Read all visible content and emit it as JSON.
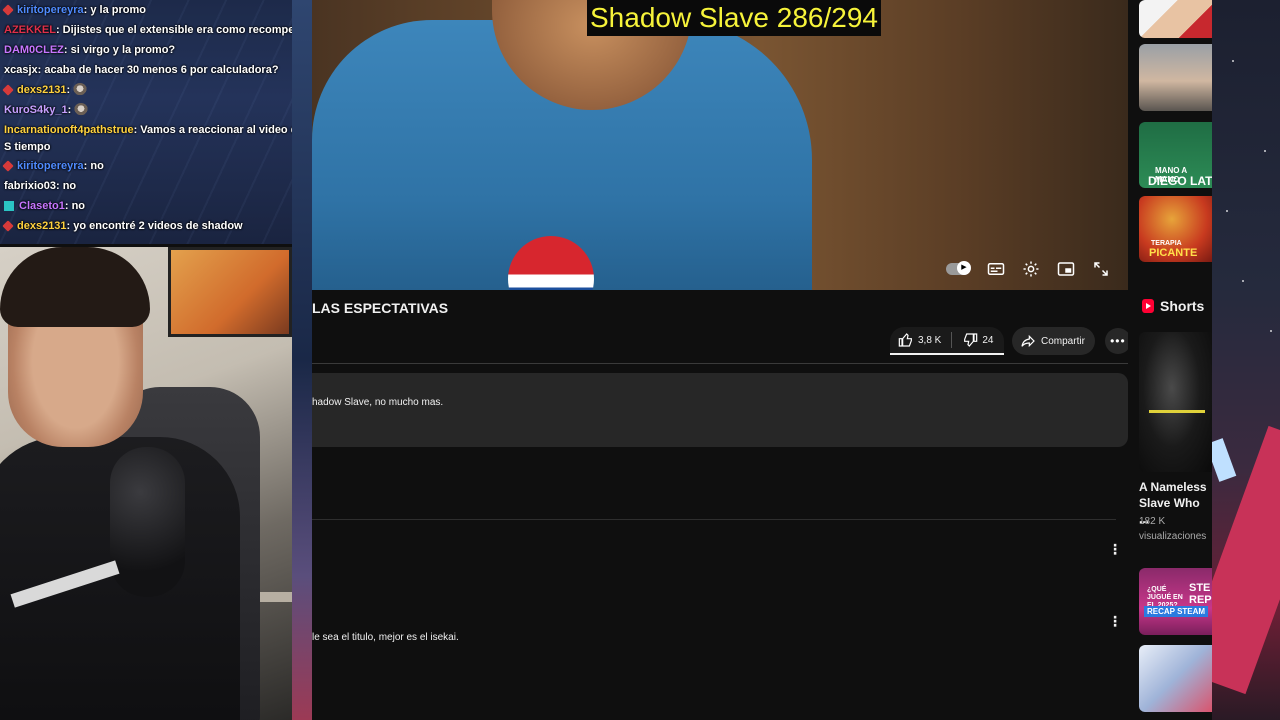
{
  "overlay": {
    "title": "Shadow Slave 286/294"
  },
  "chat": {
    "messages": [
      {
        "user": "kiritopereyra",
        "text": ": y la promo",
        "user_color": "#4f8bff",
        "badge": "#d63a3a"
      },
      {
        "user": "AZEKKEL",
        "text": ": Dijistes que el extensible era como recompensa p",
        "user_color": "#e0304a",
        "badge": ""
      },
      {
        "user": "DAM0CLEZ",
        "text": ": si virgo y la promo?",
        "user_color": "#c776ff",
        "badge": ""
      },
      {
        "user": "xcasjx",
        "text": ": acaba de hacer 30 menos 6 por calculadora?",
        "user_color": "#ffffff",
        "badge": ""
      },
      {
        "user": "dexs2131",
        "text": ":",
        "user_color": "#ffd23f",
        "badge": "#d63a3a"
      },
      {
        "user": "KuroS4ky_1",
        "text": ":",
        "user_color": "#c7a0ff",
        "badge": ""
      },
      {
        "user": "Incarnationoft4pathstrue",
        "text": ": Vamos a reaccionar al video del S tiempo",
        "user_color": "#ffd23f",
        "badge": ""
      },
      {
        "user": "kiritopereyra",
        "text": ": no",
        "user_color": "#4f8bff",
        "badge": "#d63a3a"
      },
      {
        "user": "fabrixio03",
        "text": ": no",
        "user_color": "#ffffff",
        "badge": ""
      },
      {
        "user": "Claseto1",
        "text": ": no",
        "user_color": "#c776ff",
        "badge": "#2bc4c4"
      },
      {
        "user": "dexs2131",
        "text": ": yo encontré 2 videos de shadow",
        "user_color": "#ffd23f",
        "badge": "#d63a3a"
      }
    ]
  },
  "video": {
    "title": "LAS ESPECTATIVAS",
    "likes": "3,8 K",
    "dislikes": "24",
    "share_label": "Compartir",
    "more_label": "•••",
    "description": "hadow Slave, no mucho mas."
  },
  "comments": {
    "text": "le sea el titulo, mejor es el isekai.",
    "kebab": "⋮"
  },
  "sidebar": {
    "shorts_label": "Shorts",
    "thumb_texts": {
      "t3": "DIEGO LAT",
      "t3_top": "MANO A MANO",
      "t4": "PICANTE",
      "t4_top": "TERAPIA",
      "s2_top": "¿QUÉ JUGUÉ EN EL 2025?",
      "s2": "RECAP STEAM",
      "s2_side": "STE REP"
    },
    "short": {
      "title": "A Nameless Slave Who ...",
      "views": "182 K visualizaciones"
    }
  },
  "colors": {
    "accent": "#f6f33a",
    "youtube_red": "#ff0033",
    "bg": "#0f0f0f"
  }
}
